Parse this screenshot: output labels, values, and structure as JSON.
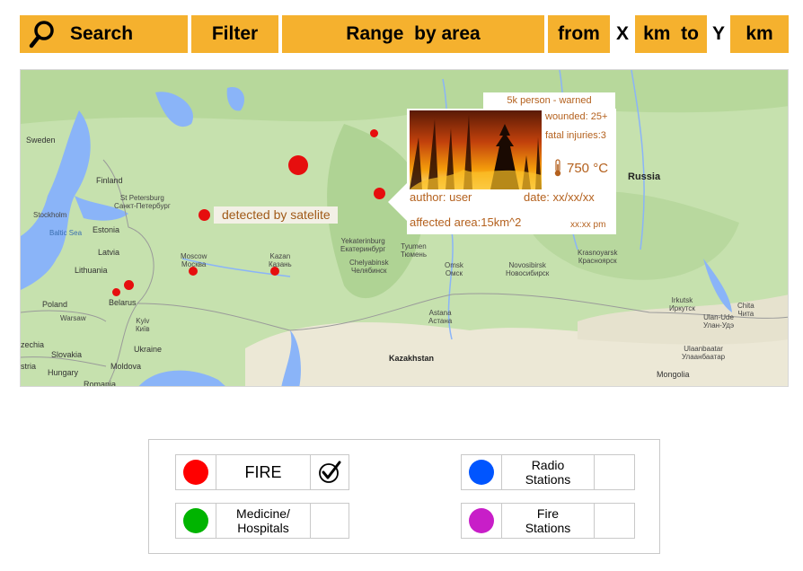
{
  "toolbar": {
    "search_label": "Search",
    "filter_label": "Filter",
    "range_label": "Range  by area",
    "from_label": "from",
    "x_label": "X",
    "km_to_label": "km  to",
    "y_label": "Y",
    "km_label": "km",
    "search_icon": "magnifier-icon"
  },
  "map": {
    "labels": {
      "sweden": "Sweden",
      "finland": "Finland",
      "stpetersburg": "St Petersburg",
      "stpetersburg_ru": "Санкт-Петербург",
      "stockholm": "Stockholm",
      "baltic": "Baltic Sea",
      "estonia": "Estonia",
      "latvia": "Latvia",
      "lithuania": "Lithuania",
      "belarus": "Belarus",
      "poland": "Poland",
      "warsaw": "Warsaw",
      "czechia": "zechia",
      "slovakia": "Slovakia",
      "austria": "stria",
      "hungary": "Hungary",
      "moldova": "Moldova",
      "romania": "Romania",
      "ukraine": "Ukraine",
      "kyiv": "Kyiv",
      "kyiv_local": "Київ",
      "moscow": "Moscow",
      "moscow_ru": "Москва",
      "kazan": "Kazan",
      "kazan_ru": "Казань",
      "yekaterinburg": "Yekaterinburg",
      "yekaterinburg_ru": "Екатеринбург",
      "tyumen": "Tyumen",
      "tyumen_ru": "Тюмень",
      "chelyabinsk": "Chelyabinsk",
      "chelyabinsk_ru": "Челябинск",
      "omsk": "Omsk",
      "omsk_ru": "Омск",
      "novosibirsk": "Novosibirsk",
      "novosibirsk_ru": "Новосибирск",
      "krasnoyarsk": "Krasnoyarsk",
      "krasnoyarsk_ru": "Красноярск",
      "astana": "Astana",
      "astana_ru": "Астана",
      "kazakhstan": "Kazakhstan",
      "russia": "Russia",
      "irkutsk": "Irkutsk",
      "irkutsk_ru": "Иркутск",
      "ulanude": "Ulan-Ude",
      "ulanude_ru": "Улан-Удэ",
      "chita": "Chita",
      "chita_ru": "Чита",
      "ulaanbaatar": "Ulaanbaatar",
      "ulaanbaatar_mn": "Улаанбаатар",
      "mongolia": "Mongolia"
    },
    "satellite_label": "detected by satelite",
    "fire_color": "#e60e0e"
  },
  "popup": {
    "header": "5k person - warned",
    "wounded": "wounded:  25+",
    "fatal": "fatal injuries:3",
    "temperature": "750 °C",
    "temp_icon": "thermometer-icon",
    "author": "author: user",
    "date": "date: xx/xx/xx",
    "area": "affected area:15km^2",
    "time": "xx:xx pm"
  },
  "legend": {
    "items": [
      {
        "label": "FIRE",
        "color": "#ff0000",
        "checked": true
      },
      {
        "label": "Radio\nStations",
        "color": "#0055ff",
        "checked": false
      },
      {
        "label": "Medicine/\nHospitals",
        "color": "#00b400",
        "checked": false
      },
      {
        "label": "Fire\nStations",
        "color": "#c81ec8",
        "checked": false
      }
    ],
    "check_icon": "checkmark-icon"
  }
}
